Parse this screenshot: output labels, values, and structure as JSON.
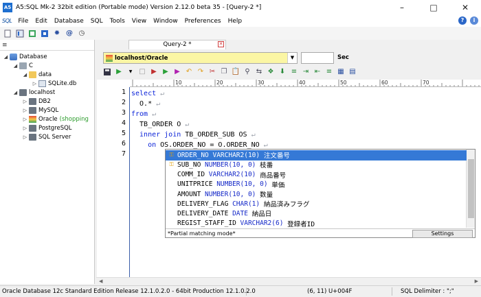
{
  "window": {
    "title": "A5:SQL Mk-2 32bit edition (Portable mode) Version 2.12.0 beta 35 - [Query-2 *]"
  },
  "menu": {
    "items": [
      "File",
      "Edit",
      "Database",
      "SQL",
      "Tools",
      "View",
      "Window",
      "Preferences",
      "Help"
    ]
  },
  "tree": {
    "root": "Database",
    "c": "C",
    "data": "data",
    "sqlite": "SQLite.db",
    "localhost": "localhost",
    "db2": "DB2",
    "mysql": "MySQL",
    "oracle": "Oracle",
    "oracle_note": "(shopping",
    "postgresql": "PostgreSQL",
    "sqlserver": "SQL Server"
  },
  "tab": {
    "label": "Query-2 *"
  },
  "connection": {
    "value": "localhost/Oracle",
    "sec_label": "Sec",
    "sec_value": ""
  },
  "ruler": {
    "labels": [
      "10",
      "20",
      "30",
      "40",
      "50",
      "60",
      "70"
    ]
  },
  "editor": {
    "line_numbers": [
      "1",
      "2",
      "3",
      "4",
      "5",
      "6",
      "7"
    ],
    "lines": [
      [
        {
          "t": "select",
          "k": true
        }
      ],
      [
        {
          "t": "  O.*",
          "k": false
        }
      ],
      [
        {
          "t": "from",
          "k": true
        }
      ],
      [
        {
          "t": "  TB_ORDER O",
          "k": false
        }
      ],
      [
        {
          "t": "  inner join",
          "k": true
        },
        {
          "t": " TB_ORDER_SUB OS",
          "k": false
        }
      ],
      [
        {
          "t": "    on",
          "k": true
        },
        {
          "t": " OS.ORDER_NO = O.ORDER_NO",
          "k": false
        }
      ],
      []
    ]
  },
  "completion": {
    "items": [
      {
        "name": "ORDER_NO",
        "type": "VARCHAR2(10)",
        "comment": "注文番号"
      },
      {
        "name": "SUB_NO",
        "type": "NUMBER(10, 0)",
        "comment": "枝番"
      },
      {
        "name": "COMM_ID",
        "type": "VARCHAR2(10)",
        "comment": "商品番号"
      },
      {
        "name": "UNITPRICE",
        "type": "NUMBER(10, 0)",
        "comment": "単価"
      },
      {
        "name": "AMOUNT",
        "type": "NUMBER(10, 0)",
        "comment": "数量"
      },
      {
        "name": "DELIVERY_FLAG",
        "type": "CHAR(1)",
        "comment": "納品済みフラグ"
      },
      {
        "name": "DELIVERY_DATE",
        "type": "DATE",
        "comment": "納品日"
      },
      {
        "name": "REGIST_STAFF_ID",
        "type": "VARCHAR2(6)",
        "comment": "登録者ID"
      }
    ],
    "footer": "*Partial matching mode*",
    "settings": "Settings"
  },
  "status": {
    "db": "Oracle Database 12c Standard Edition Release 12.1.0.2.0 - 64bit Production 12.1.0.2.0",
    "pos": "(6, 11) U+004F",
    "delim": "SQL Delimiter : \";\""
  }
}
